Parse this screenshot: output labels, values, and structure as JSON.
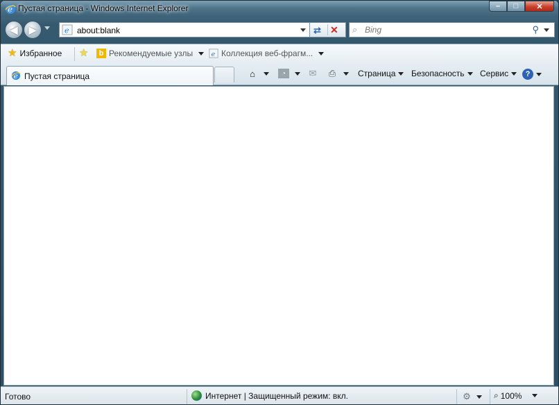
{
  "window": {
    "title": "Пустая страница - Windows Internet Explorer",
    "caption": {
      "minimize": "–",
      "maximize": "□",
      "close": "✕"
    }
  },
  "nav": {
    "back_glyph": "◀",
    "forward_glyph": "▶",
    "address": "about:blank",
    "refresh_glyph": "⇄",
    "stop_glyph": "✕"
  },
  "search": {
    "placeholder": "Bing",
    "search_glyph": "⚲"
  },
  "favorites_bar": {
    "favorites_label": "Избранное",
    "suggested_sites": "Рекомендуемые узлы",
    "web_slice_gallery": "Коллекция веб-фрагм..."
  },
  "tabs": [
    {
      "title": "Пустая страница"
    }
  ],
  "command_bar": {
    "page": "Страница",
    "safety": "Безопасность",
    "tools": "Сервис",
    "help_glyph": "?"
  },
  "status": {
    "text": "Готово",
    "zone": "Интернет | Защищенный режим: вкл.",
    "zoom": "100%"
  },
  "colors": {
    "frame": "#35596e",
    "close_button": "#c8402c",
    "toolbar": "#e6eef3",
    "content": "#ffffff"
  }
}
